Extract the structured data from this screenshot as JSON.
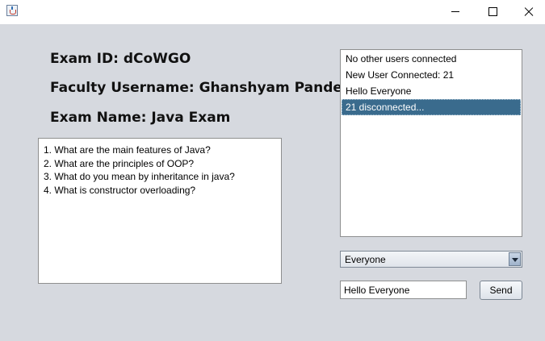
{
  "window": {
    "title": ""
  },
  "exam": {
    "id_line": "Exam ID: dCoWGO",
    "faculty_line": "Faculty Username: Ghanshyam Pandey",
    "name_line": "Exam Name: Java Exam"
  },
  "questions": [
    "1. What are the main features of Java?",
    "2. What are the principles of OOP?",
    "3. What do you mean by inheritance in java?",
    "4. What is constructor overloading?"
  ],
  "messages": [
    {
      "text": "No other users connected",
      "selected": false
    },
    {
      "text": "New User Connected: 21",
      "selected": false
    },
    {
      "text": "Hello Everyone",
      "selected": false
    },
    {
      "text": "21 disconnected...",
      "selected": true
    }
  ],
  "recipient": {
    "selected": "Everyone"
  },
  "composer": {
    "value": "Hello Everyone",
    "send_label": "Send"
  },
  "colors": {
    "background": "#d6d9df",
    "selection": "#3a6b8d"
  }
}
